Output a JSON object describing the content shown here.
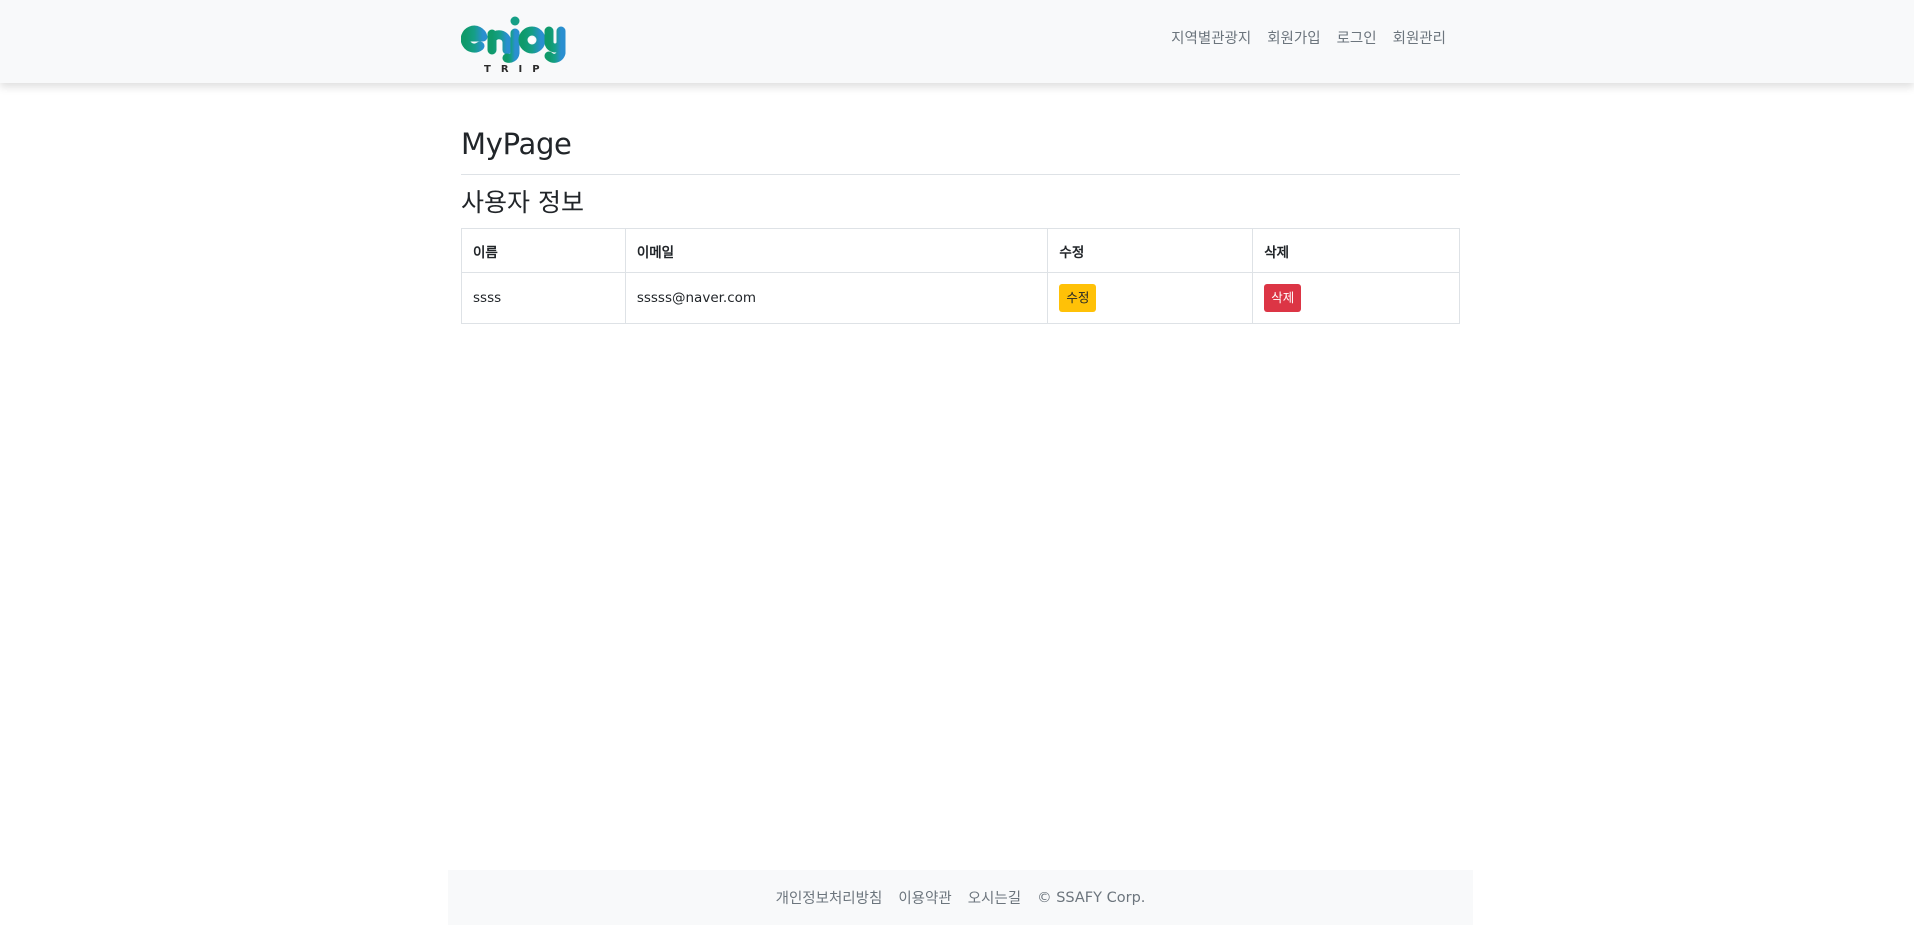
{
  "header": {
    "logo_text": "enjoy",
    "logo_subtext": "TRIP",
    "nav": [
      {
        "label": "지역별관광지"
      },
      {
        "label": "회원가입"
      },
      {
        "label": "로그인"
      },
      {
        "label": "회원관리"
      }
    ]
  },
  "main": {
    "page_title": "MyPage",
    "section_title": "사용자 정보",
    "table": {
      "columns": [
        "이름",
        "이메일",
        "수정",
        "삭제"
      ],
      "rows": [
        {
          "name": "ssss",
          "email": "sssss@naver.com",
          "edit_label": "수정",
          "delete_label": "삭제"
        }
      ]
    }
  },
  "footer": {
    "links": [
      {
        "label": "개인정보처리방침"
      },
      {
        "label": "이용약관"
      },
      {
        "label": "오시는길"
      }
    ],
    "copyright": "© SSAFY Corp."
  },
  "colors": {
    "navbar_bg": "#f8f9fa",
    "edit_button": "#ffc107",
    "delete_button": "#dc3545",
    "logo_green": "#0f9a6a",
    "logo_blue": "#2a8fd0"
  }
}
